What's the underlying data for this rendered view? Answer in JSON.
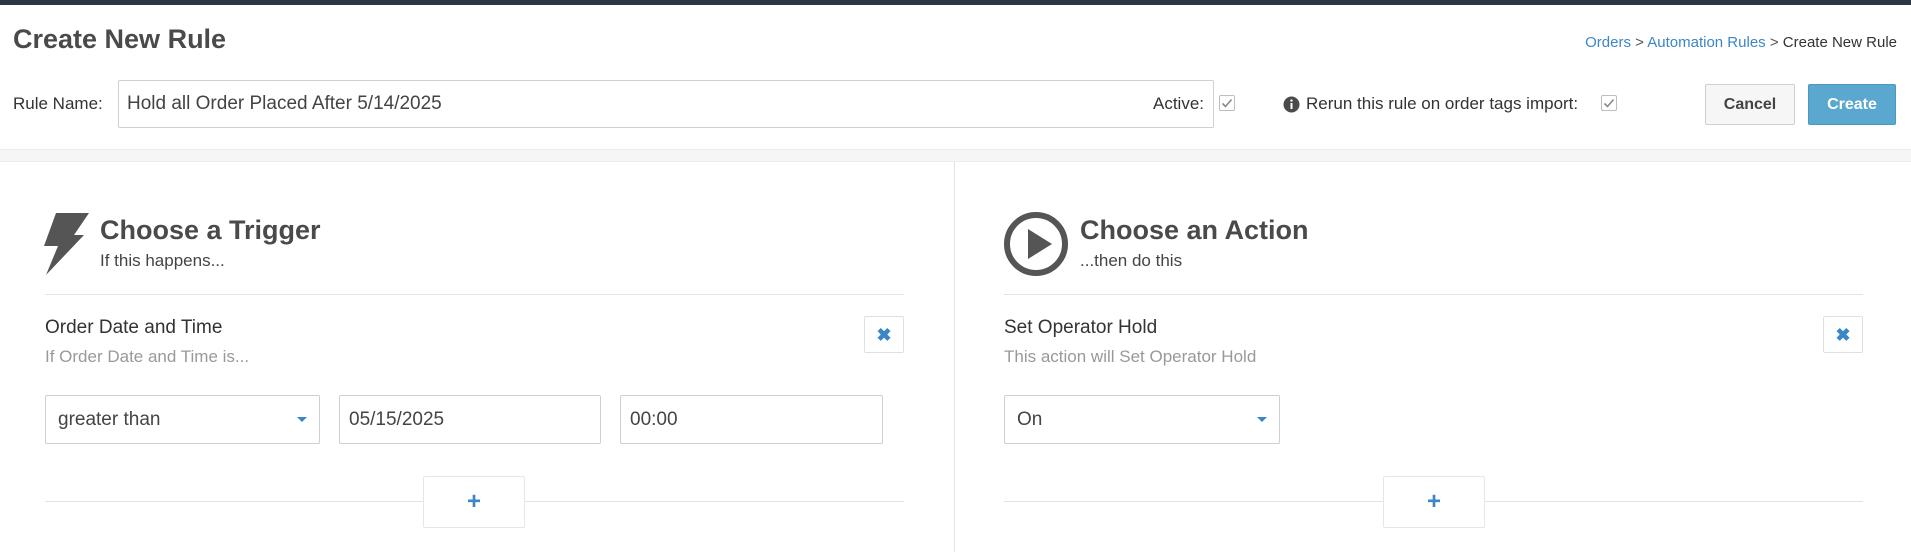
{
  "page": {
    "title": "Create New Rule"
  },
  "breadcrumb": {
    "items": [
      "Orders",
      "Automation Rules",
      "Create New Rule"
    ],
    "separator": ">"
  },
  "rule_name": {
    "label": "Rule Name:",
    "value": "Hold all Order Placed After 5/14/2025"
  },
  "active": {
    "label": "Active:",
    "checked": true
  },
  "rerun": {
    "label": "Rerun this rule on order tags import:",
    "checked": true,
    "icon": "info-icon"
  },
  "buttons": {
    "cancel": "Cancel",
    "create": "Create"
  },
  "trigger": {
    "icon": "lightning-bolt-icon",
    "title": "Choose a Trigger",
    "subtitle": "If this happens...",
    "item": {
      "title": "Order Date and Time",
      "description": "If Order Date and Time is...",
      "operator": "greater than",
      "date": "05/15/2025",
      "time": "00:00"
    },
    "add_label": "+"
  },
  "action": {
    "icon": "play-circle-icon",
    "title": "Choose an Action",
    "subtitle": "...then do this",
    "item": {
      "title": "Set Operator Hold",
      "description": "This action will Set Operator Hold",
      "value": "On"
    },
    "add_label": "+"
  },
  "colors": {
    "accent": "#3b86c6",
    "primary_button": "#5aa7cf",
    "top_bar": "#2b3742"
  }
}
